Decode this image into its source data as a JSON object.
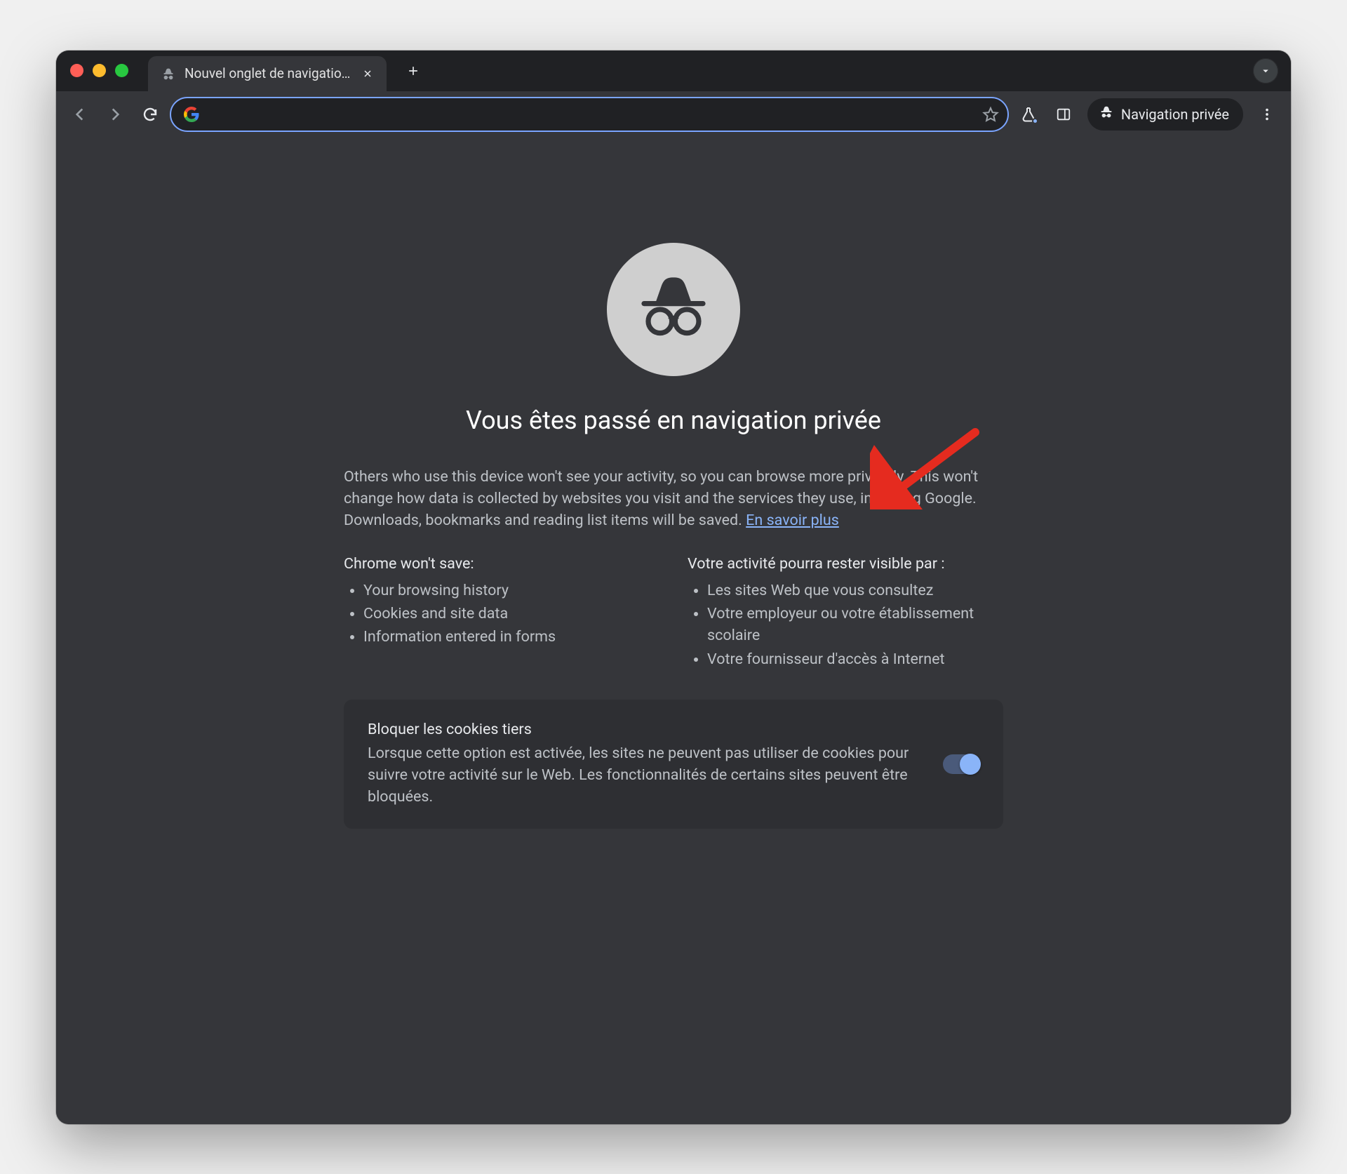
{
  "tab": {
    "title": "Nouvel onglet de navigation privée"
  },
  "toolbar": {
    "incognito_label": "Navigation privée"
  },
  "page": {
    "heading": "Vous êtes passé en navigation privée",
    "description_pre": "Others who use this device won't see your activity, so you can browse more privately. This won't change how data is collected by websites you visit and the services they use, including Google. Downloads, bookmarks and reading list items will be saved. ",
    "learn_more": "En savoir plus",
    "col1_title": "Chrome won't save:",
    "col1_items": [
      "Your browsing history",
      "Cookies and site data",
      "Information entered in forms"
    ],
    "col2_title": "Votre activité pourra rester visible par :",
    "col2_items": [
      "Les sites Web que vous consultez",
      "Votre employeur ou votre établissement scolaire",
      "Votre fournisseur d'accès à Internet"
    ],
    "cookies_title": "Bloquer les cookies tiers",
    "cookies_desc": "Lorsque cette option est activée, les sites ne peuvent pas utiliser de cookies pour suivre votre activité sur le Web. Les fonctionnalités de certains sites peuvent être bloquées."
  }
}
